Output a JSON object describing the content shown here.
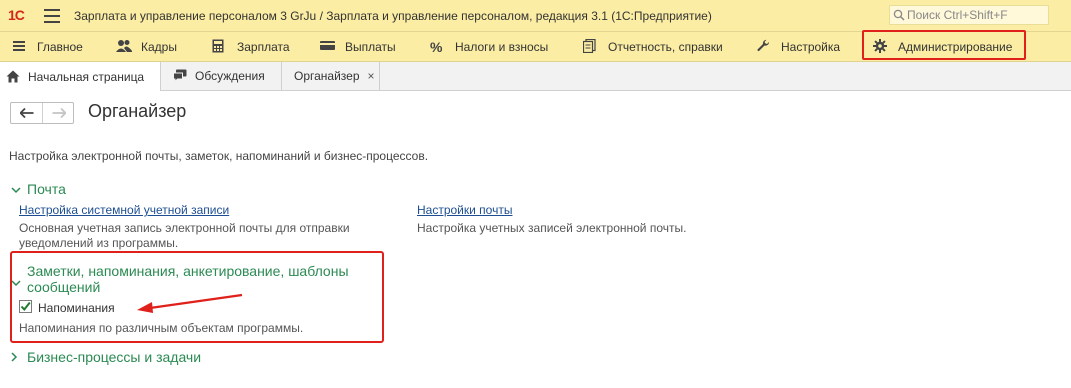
{
  "window": {
    "logo_text": "1С",
    "title": "Зарплата и управление персоналом 3 GrJu / Зарплата и управление персоналом, редакция 3.1  (1С:Предприятие)",
    "search_placeholder": "Поиск Ctrl+Shift+F"
  },
  "menu": {
    "items": [
      {
        "label": "Главное",
        "icon": "hamburger-icon"
      },
      {
        "label": "Кадры",
        "icon": "people-icon"
      },
      {
        "label": "Зарплата",
        "icon": "calculator-icon"
      },
      {
        "label": "Выплаты",
        "icon": "wallet-icon"
      },
      {
        "label": "Налоги и взносы",
        "icon": "percent-icon"
      },
      {
        "label": "Отчетность, справки",
        "icon": "documents-icon"
      },
      {
        "label": "Настройка",
        "icon": "wrench-icon"
      },
      {
        "label": "Администрирование",
        "icon": "gear-icon"
      }
    ]
  },
  "tabs": [
    {
      "label": "Начальная страница",
      "icon": "home-icon"
    },
    {
      "label": "Обсуждения",
      "icon": "chat-icon"
    },
    {
      "label": "Органайзер",
      "close": "×"
    }
  ],
  "page": {
    "title": "Органайзер",
    "description": "Настройка электронной почты, заметок, напоминаний и бизнес-процессов.",
    "sections": {
      "mail": {
        "title": "Почта",
        "link1": "Настройка системной учетной записи",
        "note1": "Основная учетная запись электронной почты для отправки уведомлений из программы.",
        "link2": "Настройки почты",
        "note2": "Настройка учетных записей электронной почты."
      },
      "notes": {
        "title": "Заметки, напоминания, анкетирование, шаблоны сообщений",
        "checkbox_label": "Напоминания",
        "checkbox_checked": true,
        "note": "Напоминания по различным объектам программы."
      },
      "bp": {
        "title": "Бизнес-процессы и задачи"
      }
    }
  },
  "colors": {
    "accent_bar": "#fbeda4",
    "section_green": "#2b8a53",
    "link_blue": "#1d4e91",
    "highlight_red": "#e0201b"
  }
}
